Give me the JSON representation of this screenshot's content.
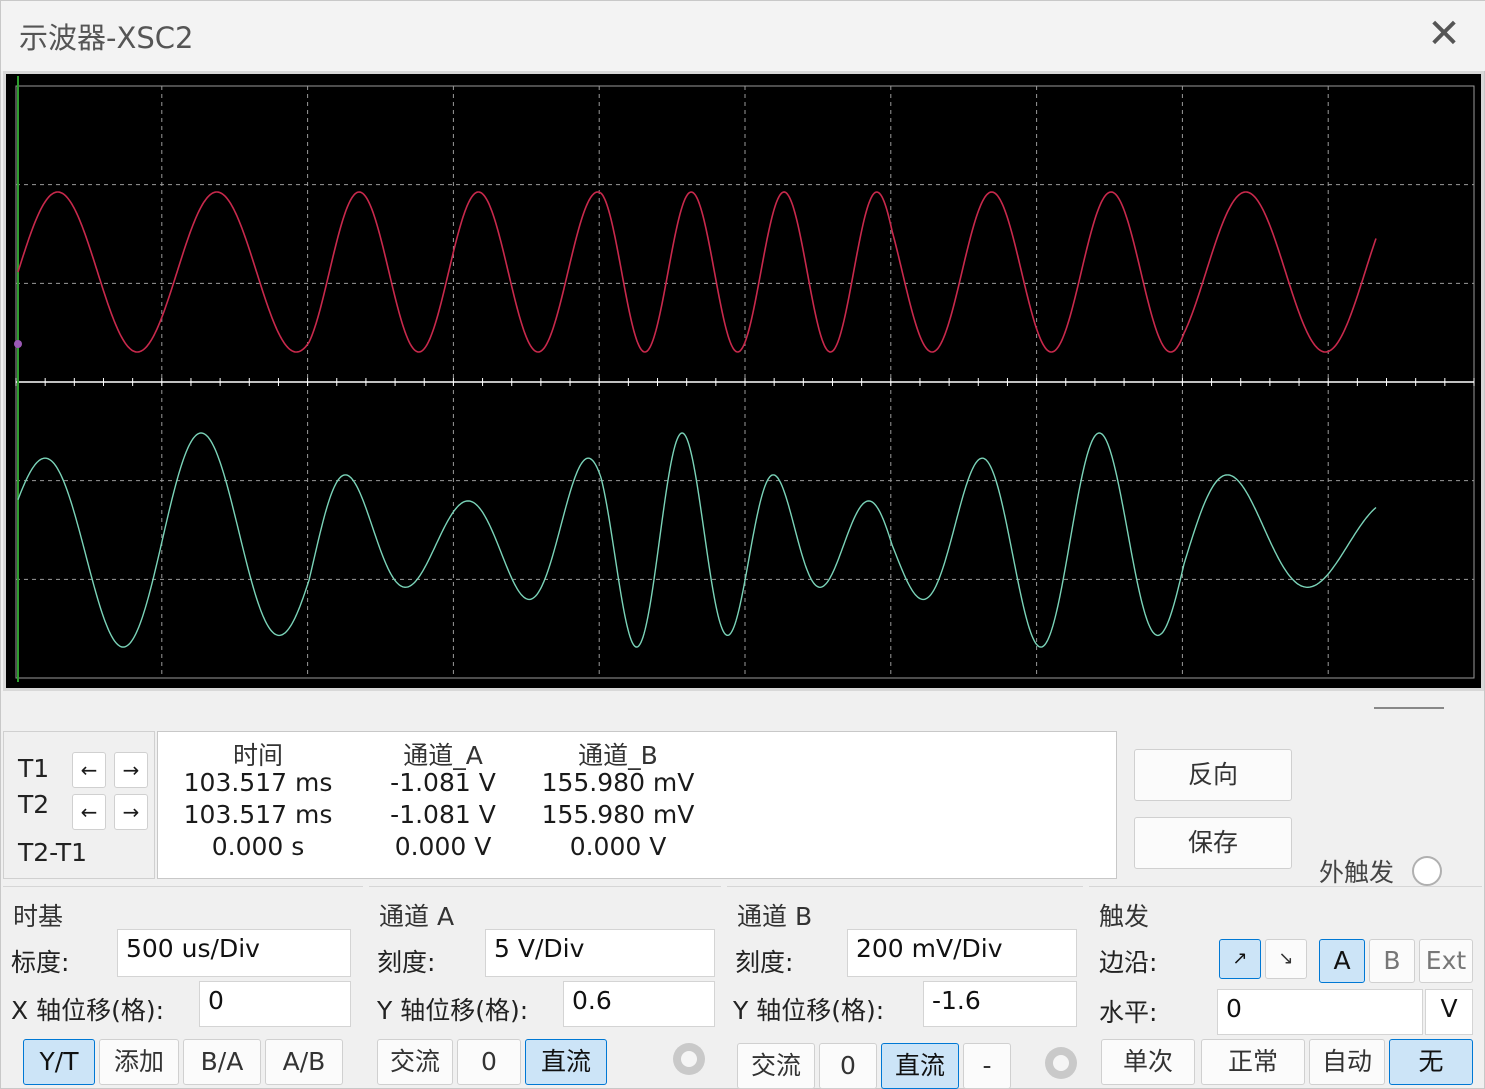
{
  "window": {
    "title": "示波器-XSC2",
    "close_glyph": "✕"
  },
  "colors": {
    "channel_a": "#c8294c",
    "channel_b": "#7ad3b8",
    "grid": "#9a9a9a",
    "axis": "#ffffff",
    "screen": "#000000",
    "trigger_marker": "#2e9e2e"
  },
  "scope": {
    "channel_a": {
      "periods_ms": [
        0.6,
        0.45,
        0.35,
        0.45
      ],
      "segment_divs": [
        2,
        2,
        2,
        2
      ]
    },
    "channel_b": {
      "segment_divs": [
        2,
        2,
        2,
        2
      ]
    }
  },
  "cursors": {
    "t1_label": "T1",
    "t2_label": "T2",
    "diff_label": "T2-T1",
    "left_arrow": "←",
    "right_arrow": "→"
  },
  "readout": {
    "headers": [
      "时间",
      "通道_A",
      "通道_B"
    ],
    "rows": [
      [
        "103.517 ms",
        "-1.081 V",
        "155.980 mV"
      ],
      [
        "103.517 ms",
        "-1.081 V",
        "155.980 mV"
      ],
      [
        "0.000 s",
        "0.000 V",
        "0.000 V"
      ]
    ]
  },
  "side_buttons": {
    "reverse": "反向",
    "save": "保存",
    "ext_trigger": "外触发"
  },
  "timebase": {
    "title": "时基",
    "scale_label": "标度:",
    "scale_value": "500 us/Div",
    "xpos_label": "X 轴位移(格):",
    "xpos_value": "0",
    "modes": [
      "Y/T",
      "添加",
      "B/A",
      "A/B"
    ],
    "active_mode": 0
  },
  "channel_a": {
    "title": "通道 A",
    "scale_label": "刻度:",
    "scale_value": "5  V/Div",
    "ypos_label": "Y 轴位移(格):",
    "ypos_value": "0.6",
    "coupling": [
      "交流",
      "0",
      "直流"
    ],
    "active_coupling": 2
  },
  "channel_b": {
    "title": "通道 B",
    "scale_label": "刻度:",
    "scale_value": "200 mV/Div",
    "ypos_label": "Y 轴位移(格):",
    "ypos_value": "-1.6",
    "coupling": [
      "交流",
      "0",
      "直流",
      "-"
    ],
    "active_coupling": 2
  },
  "trigger": {
    "title": "触发",
    "edge_label": "边沿:",
    "edge_rise": "↗",
    "edge_fall": "↘",
    "sources": [
      "A",
      "B",
      "Ext"
    ],
    "active_source": 0,
    "level_label": "水平:",
    "level_value": "0",
    "level_unit": "V",
    "modes": [
      "单次",
      "正常",
      "自动",
      "无"
    ],
    "active_mode": 3
  }
}
